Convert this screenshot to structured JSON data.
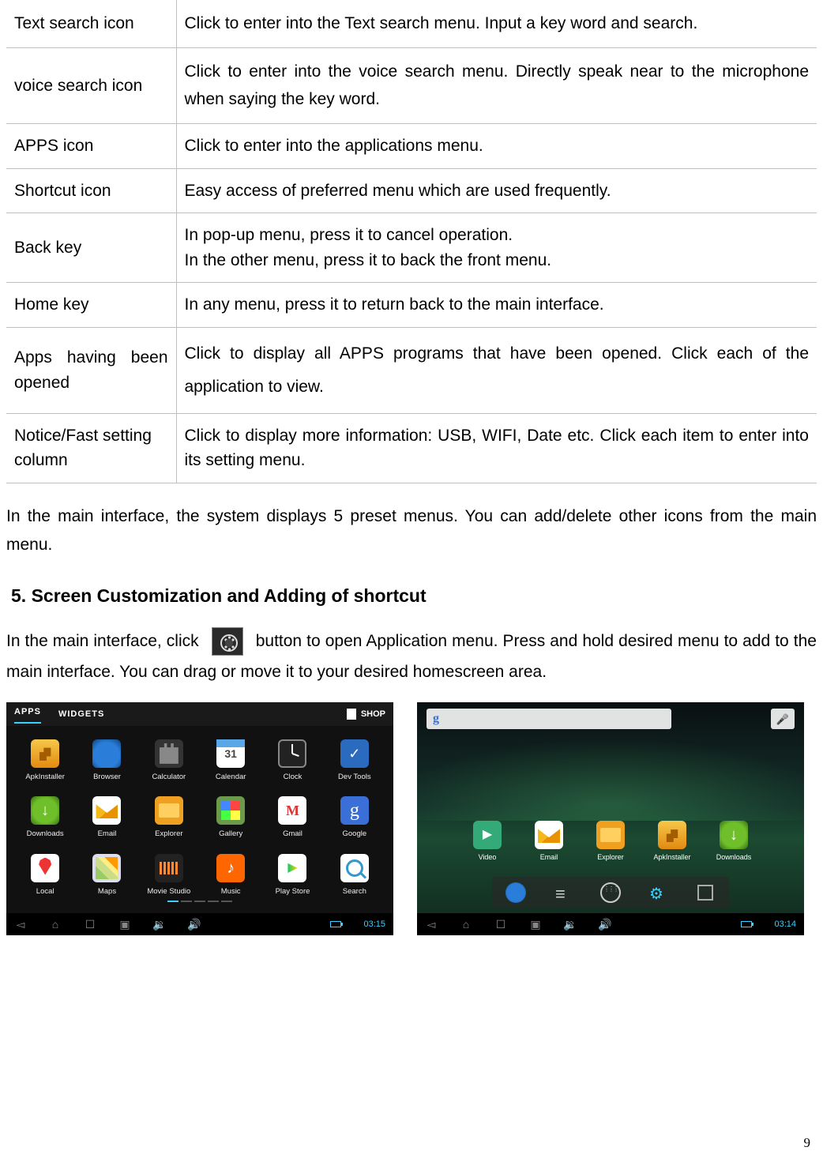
{
  "table": {
    "rows": [
      {
        "name": "Text search icon",
        "desc": "Click to enter into the Text search menu. Input a key word and search."
      },
      {
        "name": "voice search icon",
        "desc": "Click to enter into the voice search menu. Directly speak near to the microphone when saying the key word."
      },
      {
        "name": "APPS icon",
        "desc": "Click to enter into the applications menu."
      },
      {
        "name": "Shortcut icon",
        "desc": "Easy access of preferred menu which are used frequently."
      },
      {
        "name": "Back key",
        "desc_l1": "In pop-up menu, press it to cancel operation.",
        "desc_l2": "In the other menu, press it to back the front menu."
      },
      {
        "name": "Home key",
        "desc": "In any menu, press it to return back to the main interface."
      },
      {
        "name": "Apps having been opened",
        "desc": "Click to display all APPS programs that have been opened. Click each of the application to view."
      },
      {
        "name": "Notice/Fast setting column",
        "desc": "Click to display more information: USB, WIFI, Date etc. Click each item to enter into its setting menu."
      }
    ]
  },
  "para1": "In the main interface, the system displays 5 preset menus. You can add/delete other icons from the main menu.",
  "section_heading": "5. Screen Customization and Adding of shortcut",
  "para2_a": "In the main interface, click",
  "para2_b": "button to open Application menu. Press and hold desired menu to add to the main interface. You can drag or move it to your desired homescreen area.",
  "shotA": {
    "tab_apps": "APPS",
    "tab_widgets": "WIDGETS",
    "shop": "SHOP",
    "apps": [
      "ApkInstaller",
      "Browser",
      "Calculator",
      "Calendar",
      "Clock",
      "Dev Tools",
      "Downloads",
      "Email",
      "Explorer",
      "Gallery",
      "Gmail",
      "Google",
      "Local",
      "Maps",
      "Movie Studio",
      "Music",
      "Play Store",
      "Search"
    ],
    "time": "03:15"
  },
  "shotB": {
    "search_g": "g",
    "apps": [
      "Video",
      "Email",
      "Explorer",
      "ApkInstaller",
      "Downloads"
    ],
    "time": "03:14"
  },
  "page_number": "9"
}
